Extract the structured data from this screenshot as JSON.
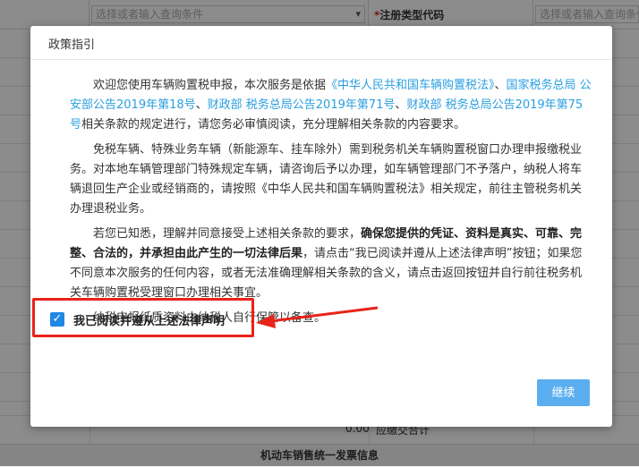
{
  "background": {
    "input_placeholder_left": "选择或者输入查询条件",
    "label_required_mark": "*",
    "label_text": "注册类型代码",
    "input_placeholder_right": "选择或者输入查询条件",
    "dropdown_arrow": "▾",
    "amount_value": "0.00",
    "amount_label": "应缴交合计",
    "section_title": "机动车销售统一发票信息"
  },
  "modal": {
    "title": "政策指引",
    "p1": {
      "text1": "欢迎您使用车辆购置税申报，本次服务是依据",
      "link1": "《中华人民共和国车辆购置税法》",
      "text2": "、",
      "link2": "国家税务总局 公安部公告2019年第18号",
      "text3": "、",
      "link3": "财政部 税务总局公告2019年第71号",
      "text4": "、",
      "link4": "财政部 税务总局公告2019年第75号",
      "text5": "相关条款的规定进行，请您务必审慎阅读，充分理解相关条款的内容要求。"
    },
    "p2": "免税车辆、特殊业务车辆（新能源车、挂车除外）需到税务机关车辆购置税窗口办理申报缴税业务。对本地车辆管理部门特殊规定车辆，请咨询后予以办理，如车辆管理部门不予落户，纳税人将车辆退回生产企业或经销商的，请按照《中华人民共和国车辆购置税法》相关规定，前往主管税务机关办理退税业务。",
    "p3": {
      "text1": "若您已知悉，理解并同意接受上述相关条款的要求，",
      "bold": "确保您提供的凭证、资料是真实、可靠、完整、合法的，并承担由此产生的一切法律后果",
      "text2": "，请点击“我已阅读并遵从上述法律声明”按钮；如果您不同意本次服务的任何内容，或者无法准确理解相关条款的含义，请点击返回按钮并自行前往税务机关车辆购置税受理窗口办理相关事宜。"
    },
    "p4": "纳税申报纸质资料由纳税人自行保管以备查。",
    "agree_label": "我已阅读并遵从上述法律声明",
    "agree_checked": true,
    "checkbox_glyph": "✓",
    "continue_label": "继续",
    "colors": {
      "link": "#2a9fe0",
      "checkbox": "#1e88e5",
      "continue_button": "#5aaef0",
      "highlight": "#e8231a"
    }
  }
}
